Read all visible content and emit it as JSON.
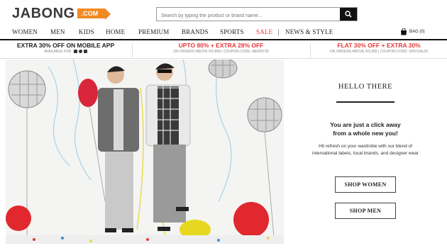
{
  "header": {
    "logo_text": "JABONG",
    "logo_badge": ".COM",
    "search_placeholder": "Search by typing the product or brand name..."
  },
  "nav": {
    "items": [
      "WOMEN",
      "MEN",
      "KIDS",
      "HOME",
      "PREMIUM",
      "BRANDS",
      "SPORTS",
      "SALE",
      "NEWS & STYLE"
    ],
    "bag_label": "BAG (0)"
  },
  "promos": [
    {
      "title": "EXTRA 30% OFF ON MOBILE APP",
      "sub": "AVAILABLE FOR"
    },
    {
      "title": "UPTO 80% + EXTRA 28% OFF",
      "sub": "ON ORDERS ABOVE RS.899 | COUPON CODE: MERRY28"
    },
    {
      "title": "FLAT 30% OFF + EXTRA 30%",
      "sub": "ON ORDERS ABOVE RS.999 | COUPON CODE: SPECIAL30"
    }
  ],
  "panel": {
    "heading": "HELLO THERE",
    "tagline_line1": "You are just a click away",
    "tagline_line2": "from a whole new you!",
    "desc_line1": "Hit refresh on your wardrobe with our blend of",
    "desc_line2": "international labels, local brands, and designer wear",
    "shop_women": "SHOP WOMEN",
    "shop_men": "SHOP MEN"
  },
  "colors": {
    "accent_orange": "#f08a24",
    "sale_red": "#e53935"
  }
}
